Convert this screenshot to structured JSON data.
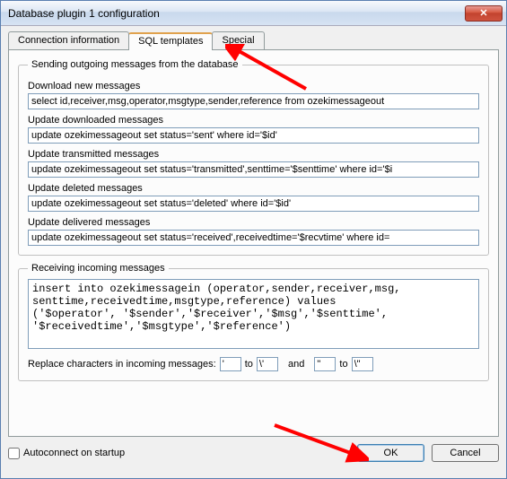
{
  "window": {
    "title": "Database plugin 1 configuration"
  },
  "tabs": {
    "conn": "Connection information",
    "sql": "SQL templates",
    "special": "Special"
  },
  "outgoing": {
    "legend": "Sending outgoing messages from the database",
    "download_label": "Download new messages",
    "download_sql": "select id,receiver,msg,operator,msgtype,sender,reference from ozekimessageout",
    "updl_label": "Update downloaded messages",
    "updl_sql": "update ozekimessageout set status='sent' where id='$id'",
    "uptx_label": "Update transmitted messages",
    "uptx_sql": "update ozekimessageout set status='transmitted',senttime='$senttime' where id='$i",
    "updel_label": "Update deleted messages",
    "updel_sql": "update ozekimessageout set status='deleted' where id='$id'",
    "updv_label": "Update delivered messages",
    "updv_sql": "update ozekimessageout set status='received',receivedtime='$recvtime' where id="
  },
  "incoming": {
    "legend": "Receiving incoming messages",
    "sql": "insert into ozekimessagein (operator,sender,receiver,msg,\nsenttime,receivedtime,msgtype,reference) values\n('$operator', '$sender','$receiver','$msg','$senttime',\n'$receivedtime','$msgtype','$reference')",
    "replace_label": "Replace characters in incoming messages:",
    "to": "to",
    "and": "and",
    "r1_from": "'",
    "r1_to": "\\'",
    "r2_from": "\"",
    "r2_to": "\\\""
  },
  "footer": {
    "autoconnect": "Autoconnect on startup",
    "ok": "OK",
    "cancel": "Cancel"
  }
}
